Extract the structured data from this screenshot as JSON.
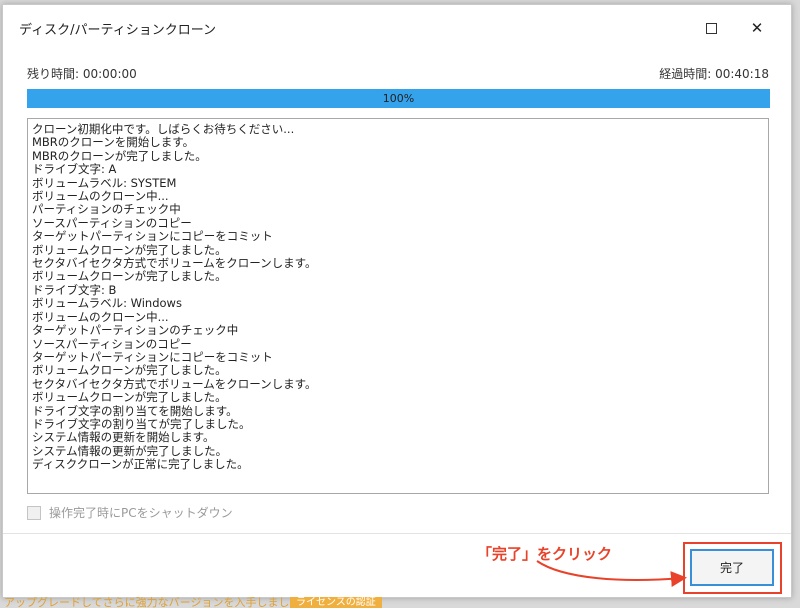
{
  "window": {
    "title": "ディスク/パーティションクローン",
    "maximize_glyph": "maximize-icon",
    "close_glyph": "✕"
  },
  "time": {
    "remaining_label": "残り時間: 00:00:00",
    "elapsed_label": "経過時間: 00:40:18"
  },
  "progress": {
    "value": 1.0,
    "label": "100%",
    "color": "#35a3ec"
  },
  "log": {
    "lines": [
      "クローン初期化中です。しばらくお待ちください...",
      "MBRのクローンを開始します。",
      "MBRのクローンが完了しました。",
      "ドライブ文字: A",
      "ボリュームラベル: SYSTEM",
      "ボリュームのクローン中...",
      "パーティションのチェック中",
      "ソースパーティションのコピー",
      "ターゲットパーティションにコピーをコミット",
      "ボリュームクローンが完了しました。",
      "セクタバイセクタ方式でボリュームをクローンします。",
      "ボリュームクローンが完了しました。",
      "ドライブ文字: B",
      "ボリュームラベル: Windows",
      "ボリュームのクローン中...",
      "ターゲットパーティションのチェック中",
      "ソースパーティションのコピー",
      "ターゲットパーティションにコピーをコミット",
      "ボリュームクローンが完了しました。",
      "セクタバイセクタ方式でボリュームをクローンします。",
      "ボリュームクローンが完了しました。",
      "ドライブ文字の割り当てを開始します。",
      "ドライブ文字の割り当てが完了しました。",
      "システム情報の更新を開始します。",
      "システム情報の更新が完了しました。",
      "ディスククローンが正常に完了しました。"
    ]
  },
  "shutdown": {
    "label": "操作完了時にPCをシャットダウン",
    "checked": false
  },
  "buttons": {
    "finish_label": "完了"
  },
  "annotation": {
    "text": "「完了」をクリック",
    "color": "#e8432a"
  },
  "footer": {
    "text": "アップグレードしてさらに強力なバージョンを入手しましょう。",
    "link_label": "ライセンスの認証"
  }
}
